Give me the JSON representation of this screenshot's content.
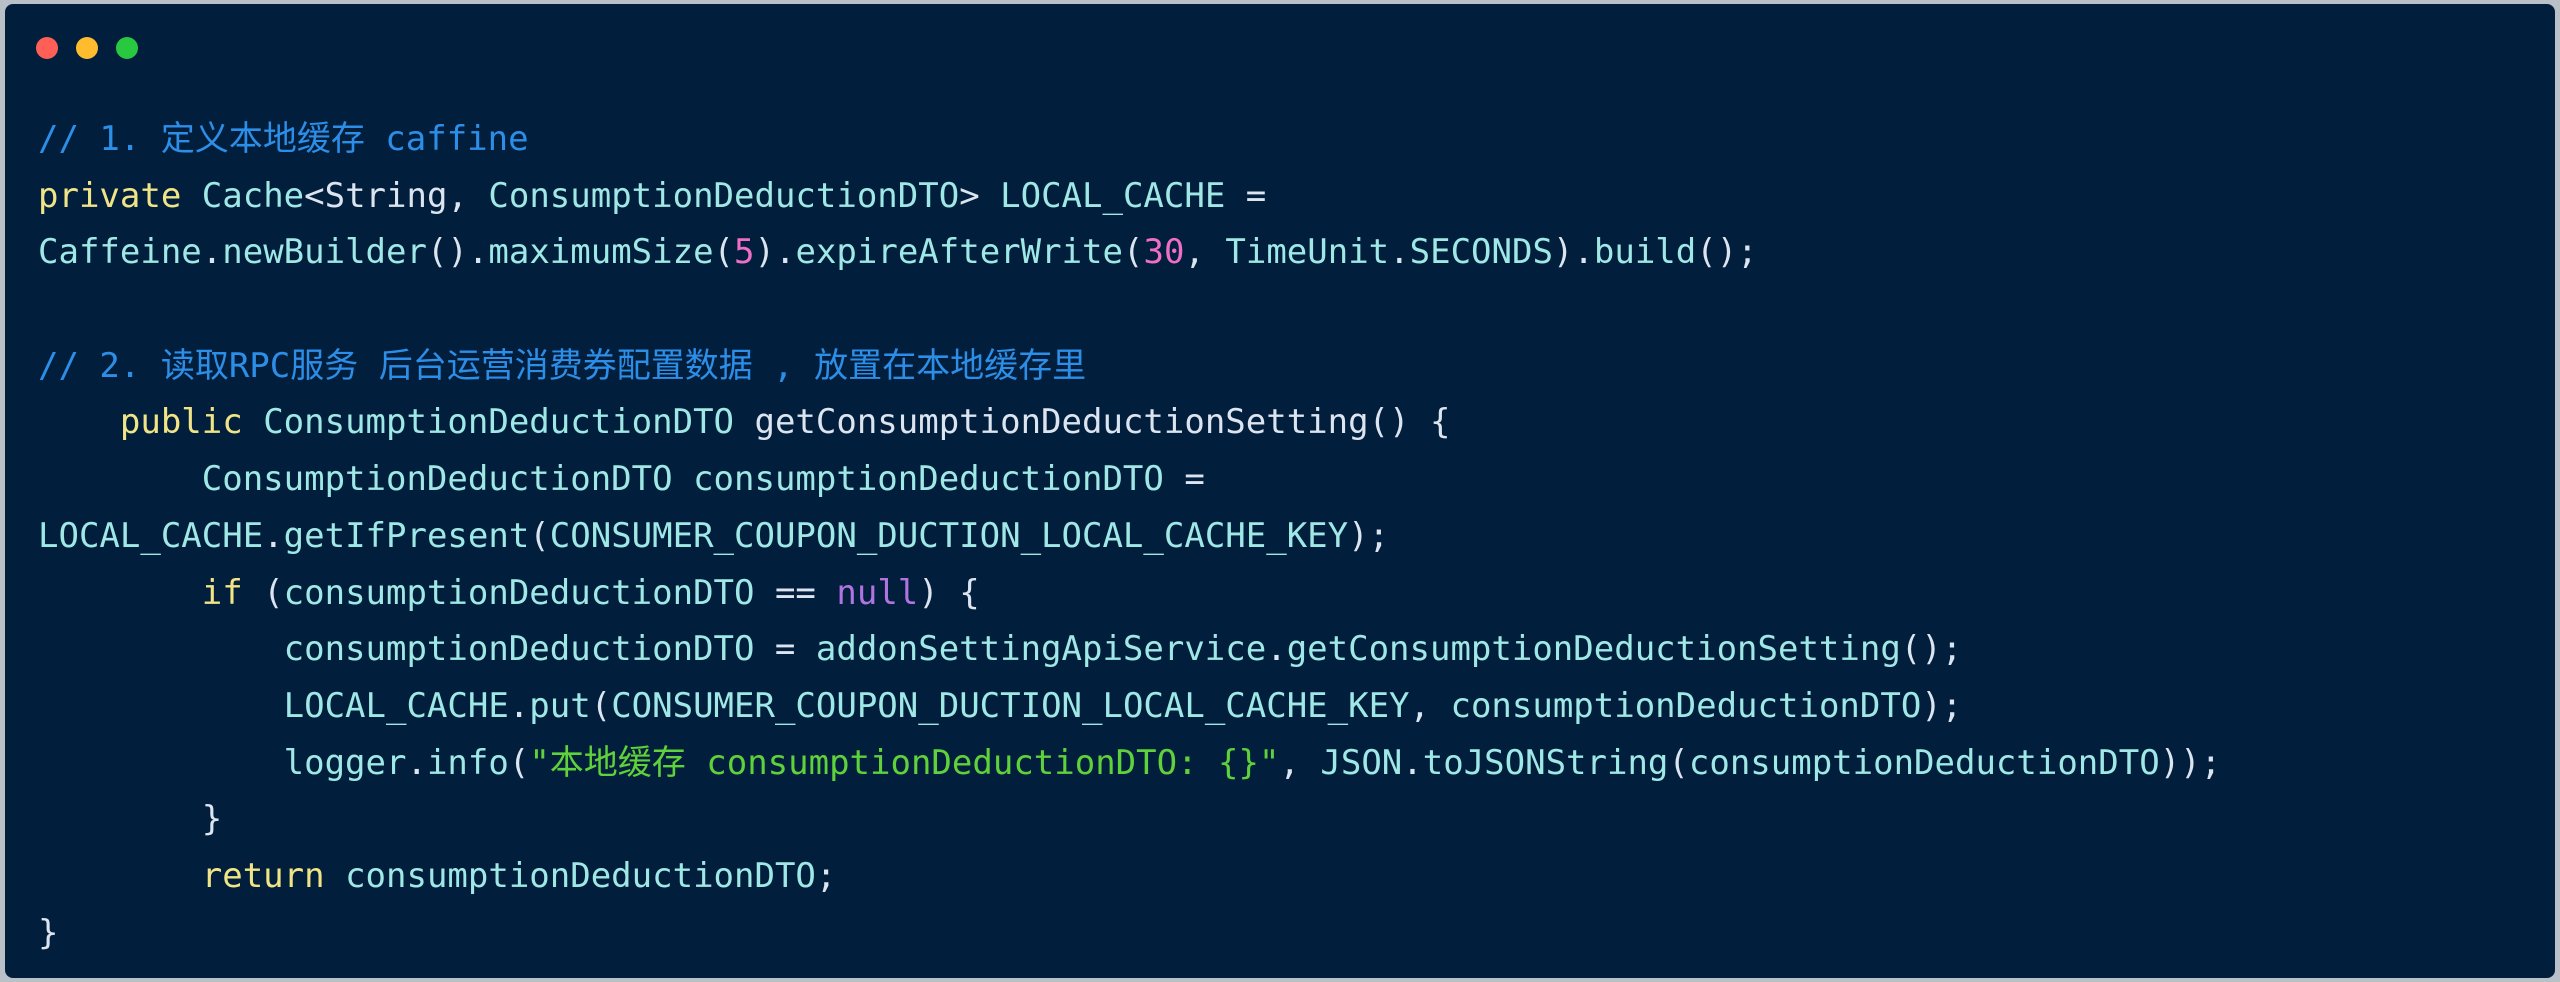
{
  "window": {
    "controls": [
      {
        "name": "close-button",
        "color": "#ff5f57"
      },
      {
        "name": "minimize-button",
        "color": "#febc2e"
      },
      {
        "name": "maximize-button",
        "color": "#28c840"
      }
    ]
  },
  "code": {
    "lines": [
      [
        {
          "cls": "comment",
          "text": "// 1. 定义本地缓存 caffine"
        }
      ],
      [
        {
          "cls": "keyword",
          "text": "private"
        },
        {
          "cls": "plain",
          "text": " "
        },
        {
          "cls": "type",
          "text": "Cache"
        },
        {
          "cls": "plain",
          "text": "<String, "
        },
        {
          "cls": "type",
          "text": "ConsumptionDeductionDTO"
        },
        {
          "cls": "plain",
          "text": "> "
        },
        {
          "cls": "type",
          "text": "LOCAL_CACHE"
        },
        {
          "cls": "plain",
          "text": " ="
        }
      ],
      [
        {
          "cls": "type",
          "text": "Caffeine"
        },
        {
          "cls": "plain",
          "text": "."
        },
        {
          "cls": "type",
          "text": "newBuilder"
        },
        {
          "cls": "plain",
          "text": "()."
        },
        {
          "cls": "type",
          "text": "maximumSize"
        },
        {
          "cls": "plain",
          "text": "("
        },
        {
          "cls": "number",
          "text": "5"
        },
        {
          "cls": "plain",
          "text": ")."
        },
        {
          "cls": "type",
          "text": "expireAfterWrite"
        },
        {
          "cls": "plain",
          "text": "("
        },
        {
          "cls": "number",
          "text": "30"
        },
        {
          "cls": "plain",
          "text": ", "
        },
        {
          "cls": "type",
          "text": "TimeUnit"
        },
        {
          "cls": "plain",
          "text": "."
        },
        {
          "cls": "type",
          "text": "SECONDS"
        },
        {
          "cls": "plain",
          "text": ")."
        },
        {
          "cls": "type",
          "text": "build"
        },
        {
          "cls": "plain",
          "text": "();"
        }
      ],
      [],
      [
        {
          "cls": "comment",
          "text": "// 2. 读取RPC服务 后台运营消费券配置数据 , 放置在本地缓存里"
        }
      ],
      [
        {
          "cls": "plain",
          "text": "    "
        },
        {
          "cls": "keyword",
          "text": "public"
        },
        {
          "cls": "plain",
          "text": " "
        },
        {
          "cls": "type",
          "text": "ConsumptionDeductionDTO"
        },
        {
          "cls": "plain",
          "text": " getConsumptionDeductionSetting() {"
        }
      ],
      [
        {
          "cls": "plain",
          "text": "        "
        },
        {
          "cls": "type",
          "text": "ConsumptionDeductionDTO"
        },
        {
          "cls": "plain",
          "text": " "
        },
        {
          "cls": "type",
          "text": "consumptionDeductionDTO"
        },
        {
          "cls": "plain",
          "text": " ="
        }
      ],
      [
        {
          "cls": "type",
          "text": "LOCAL_CACHE"
        },
        {
          "cls": "plain",
          "text": "."
        },
        {
          "cls": "type",
          "text": "getIfPresent"
        },
        {
          "cls": "plain",
          "text": "("
        },
        {
          "cls": "type",
          "text": "CONSUMER_COUPON_DUCTION_LOCAL_CACHE_KEY"
        },
        {
          "cls": "plain",
          "text": ");"
        }
      ],
      [
        {
          "cls": "plain",
          "text": "        "
        },
        {
          "cls": "keyword",
          "text": "if"
        },
        {
          "cls": "plain",
          "text": " ("
        },
        {
          "cls": "type",
          "text": "consumptionDeductionDTO"
        },
        {
          "cls": "plain",
          "text": " == "
        },
        {
          "cls": "null",
          "text": "null"
        },
        {
          "cls": "plain",
          "text": ") {"
        }
      ],
      [
        {
          "cls": "plain",
          "text": "            "
        },
        {
          "cls": "type",
          "text": "consumptionDeductionDTO"
        },
        {
          "cls": "plain",
          "text": " = "
        },
        {
          "cls": "type",
          "text": "addonSettingApiService"
        },
        {
          "cls": "plain",
          "text": "."
        },
        {
          "cls": "type",
          "text": "getConsumptionDeductionSetting"
        },
        {
          "cls": "plain",
          "text": "();"
        }
      ],
      [
        {
          "cls": "plain",
          "text": "            "
        },
        {
          "cls": "type",
          "text": "LOCAL_CACHE"
        },
        {
          "cls": "plain",
          "text": "."
        },
        {
          "cls": "type",
          "text": "put"
        },
        {
          "cls": "plain",
          "text": "("
        },
        {
          "cls": "type",
          "text": "CONSUMER_COUPON_DUCTION_LOCAL_CACHE_KEY"
        },
        {
          "cls": "plain",
          "text": ", "
        },
        {
          "cls": "type",
          "text": "consumptionDeductionDTO"
        },
        {
          "cls": "plain",
          "text": ");"
        }
      ],
      [
        {
          "cls": "plain",
          "text": "            "
        },
        {
          "cls": "type",
          "text": "logger"
        },
        {
          "cls": "plain",
          "text": "."
        },
        {
          "cls": "type",
          "text": "info"
        },
        {
          "cls": "plain",
          "text": "("
        },
        {
          "cls": "string",
          "text": "\"本地缓存 consumptionDeductionDTO: {}\""
        },
        {
          "cls": "plain",
          "text": ", "
        },
        {
          "cls": "type",
          "text": "JSON"
        },
        {
          "cls": "plain",
          "text": "."
        },
        {
          "cls": "type",
          "text": "toJSONString"
        },
        {
          "cls": "plain",
          "text": "("
        },
        {
          "cls": "type",
          "text": "consumptionDeductionDTO"
        },
        {
          "cls": "plain",
          "text": "));"
        }
      ],
      [
        {
          "cls": "plain",
          "text": "        }"
        }
      ],
      [
        {
          "cls": "plain",
          "text": "        "
        },
        {
          "cls": "keyword",
          "text": "return"
        },
        {
          "cls": "plain",
          "text": " "
        },
        {
          "cls": "type",
          "text": "consumptionDeductionDTO"
        },
        {
          "cls": "plain",
          "text": ";"
        }
      ],
      [
        {
          "cls": "plain",
          "text": "}"
        }
      ]
    ]
  },
  "colors": {
    "background": "#011f3c",
    "comment": "#2d8ee8",
    "keyword": "#f1e486",
    "identifier": "#9fe8e6",
    "number": "#ef6ec6",
    "null": "#b074e0",
    "string": "#5fd13a"
  }
}
